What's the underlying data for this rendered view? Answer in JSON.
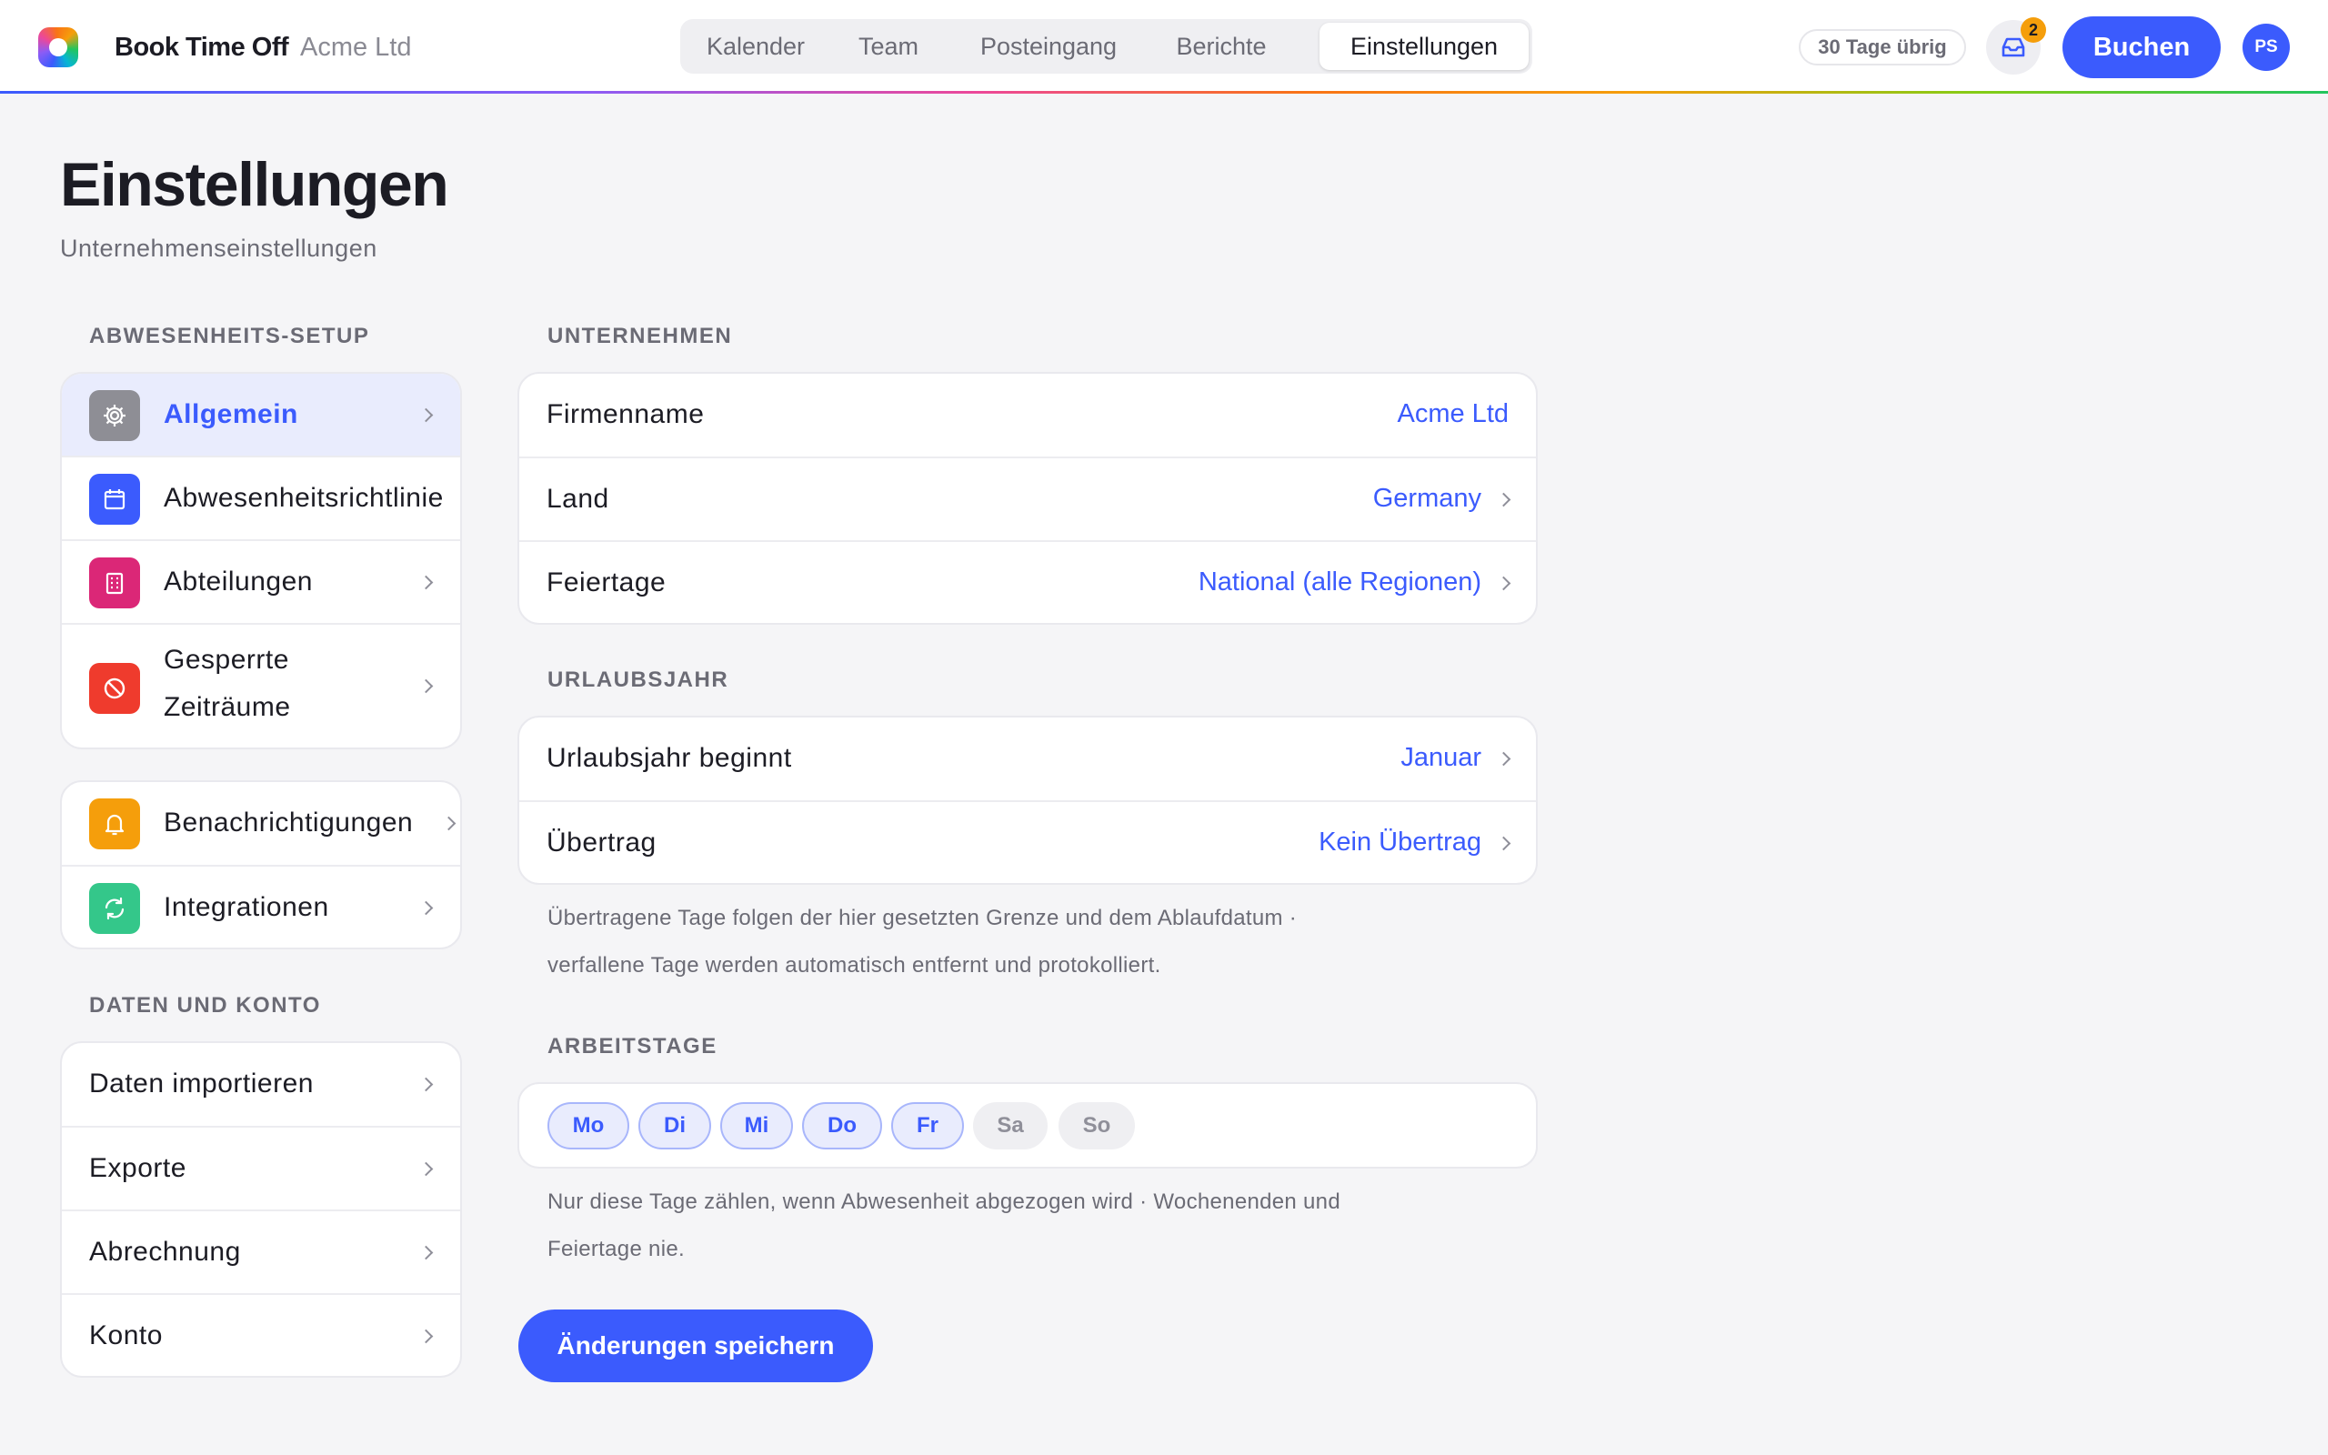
{
  "header": {
    "brand": "Book Time Off",
    "company": "Acme Ltd",
    "tabs": [
      {
        "label": "Kalender"
      },
      {
        "label": "Team"
      },
      {
        "label": "Posteingang"
      },
      {
        "label": "Berichte"
      },
      {
        "label": "Einstellungen",
        "active": true
      }
    ],
    "days_left": "30 Tage übrig",
    "inbox_badge": "2",
    "book_label": "Buchen",
    "avatar_initials": "PS"
  },
  "page": {
    "title": "Einstellungen",
    "subtitle": "Unternehmenseinstellungen"
  },
  "sidebar": {
    "section1_label": "ABWESENHEITS-SETUP",
    "group1": [
      {
        "label": "Allgemein",
        "icon": "gear-icon",
        "color": "#8e8e95",
        "active": true
      },
      {
        "label": "Abwesenheitsrichtlinie",
        "icon": "calendar-icon",
        "color": "#3b5bfd"
      },
      {
        "label": "Abteilungen",
        "icon": "building-icon",
        "color": "#db2777"
      },
      {
        "label": "Gesperrte Zeiträume",
        "label_line1": "Gesperrte",
        "label_line2": "Zeiträume",
        "icon": "blocked-icon",
        "color": "#ef3b2d"
      }
    ],
    "group2": [
      {
        "label": "Benachrichtigungen",
        "icon": "bell-icon",
        "color": "#f59e0b"
      },
      {
        "label": "Integrationen",
        "icon": "sync-icon",
        "color": "#34c78a"
      }
    ],
    "section2_label": "DATEN UND KONTO",
    "group3": [
      {
        "label": "Daten importieren"
      },
      {
        "label": "Exporte"
      },
      {
        "label": "Abrechnung"
      },
      {
        "label": "Konto"
      }
    ]
  },
  "main": {
    "company_section": {
      "label": "UNTERNEHMEN",
      "rows": [
        {
          "label": "Firmenname",
          "value": "Acme Ltd"
        },
        {
          "label": "Land",
          "value": "Germany"
        },
        {
          "label": "Feiertage",
          "value": "National (alle Regionen)"
        }
      ]
    },
    "leave_year_section": {
      "label": "URLAUBSJAHR",
      "rows": [
        {
          "label": "Urlaubsjahr beginnt",
          "value": "Januar"
        },
        {
          "label": "Übertrag",
          "value": "Kein Übertrag"
        }
      ],
      "help_line1": "Übertragene Tage folgen der hier gesetzten Grenze und dem Ablaufdatum ·",
      "help_line2": "verfallene Tage werden automatisch entfernt und protokolliert."
    },
    "workdays_section": {
      "label": "ARBEITSTAGE",
      "days": [
        {
          "label": "Mo",
          "on": true
        },
        {
          "label": "Di",
          "on": true
        },
        {
          "label": "Mi",
          "on": true
        },
        {
          "label": "Do",
          "on": true
        },
        {
          "label": "Fr",
          "on": true
        },
        {
          "label": "Sa",
          "on": false
        },
        {
          "label": "So",
          "on": false
        }
      ],
      "help_line1": "Nur diese Tage zählen, wenn Abwesenheit abgezogen wird · Wochenenden und",
      "help_line2": "Feiertage nie."
    },
    "save_label": "Änderungen speichern"
  },
  "colors": {
    "accent": "#3b5bfd",
    "badge": "#f59e0b"
  }
}
